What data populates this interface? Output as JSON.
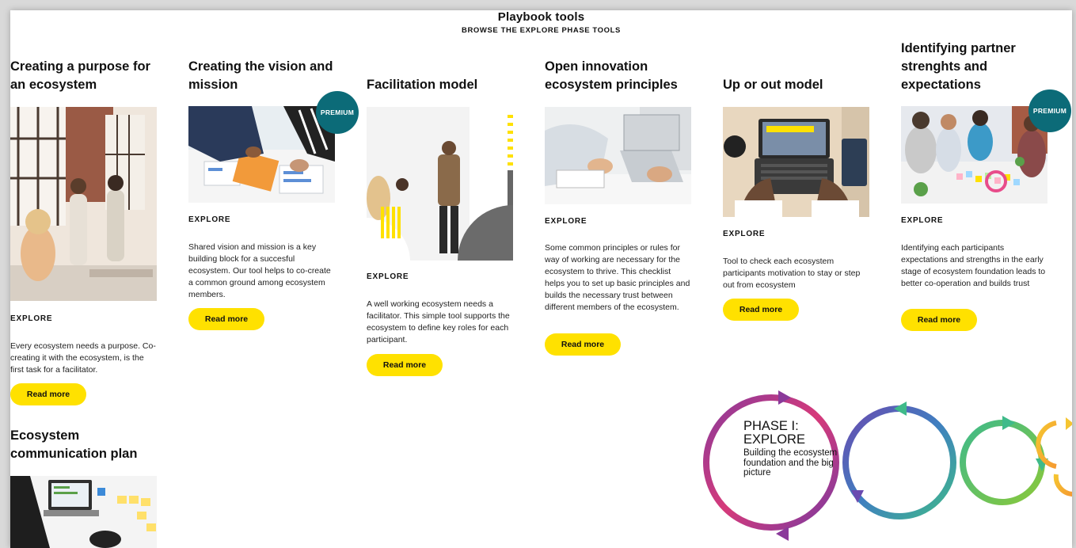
{
  "header": {
    "title": "Playbook tools",
    "subtitle": "BROWSE THE EXPLORE PHASE TOOLS"
  },
  "colors": {
    "button": "#ffe100",
    "premium_badge": "#0c6b78",
    "phase_ring_1": "#b0348c",
    "phase_ring_2": "#3f7fc0",
    "phase_ring_3": "#3fba8a",
    "phase_ring_4": "#f5b731"
  },
  "cards": [
    {
      "title": "Creating a purpose for an ecosystem",
      "image": "office-team-photo",
      "explore": "EXPLORE",
      "description": "Every ecosystem needs a purpose. Co-creating it with the ecosystem, is the first task for a facilitator.",
      "button": "Read more",
      "premium": false
    },
    {
      "title": "Creating the vision and mission",
      "image": "team-planning-photo",
      "explore": "EXPLORE",
      "description": "Shared vision and mission is a key building block for a succesful ecosystem. Our tool helps to co-create a common ground among ecosystem members.",
      "button": "Read more",
      "premium": true,
      "badge": "PREMIUM"
    },
    {
      "title": "Facilitation model",
      "image": "facilitator-whiteboard-photo",
      "explore": "EXPLORE",
      "description": "A well working ecosystem needs a facilitator. This simple tool supports the ecosystem to define key roles for each participant.",
      "button": "Read more",
      "premium": false
    },
    {
      "title": "Open innovation ecosystem principles",
      "image": "laptop-meeting-photo",
      "explore": "EXPLORE",
      "description": "Some common principles or rules for way of working are necessary for the ecosystem to thrive. This checklist helps you to set up basic principles and builds the necessary trust between different members of the ecosystem.",
      "button": "Read more",
      "premium": false
    },
    {
      "title": "Up or out model",
      "image": "laptop-desk-photo",
      "explore": "EXPLORE",
      "description": "Tool to check each ecosystem participants motivation to stay or step out from ecosystem",
      "button": "Read more",
      "premium": false
    },
    {
      "title": "Identifying partner strenghts and expectations",
      "image": "team-workshop-photo",
      "explore": "EXPLORE",
      "description": "Identifying each participants expectations and strengths in the early stage of ecosystem foundation leads to better co-operation and builds trust",
      "button": "Read more",
      "premium": true,
      "badge": "PREMIUM"
    },
    {
      "title": "Ecosystem communication plan",
      "image": "laptop-sticky-notes-photo",
      "premium": false
    }
  ],
  "phase": {
    "title_line1": "PHASE I:",
    "title_line2": "EXPLORE",
    "subtitle": "Building the ecosystem foundation and the big picture"
  }
}
